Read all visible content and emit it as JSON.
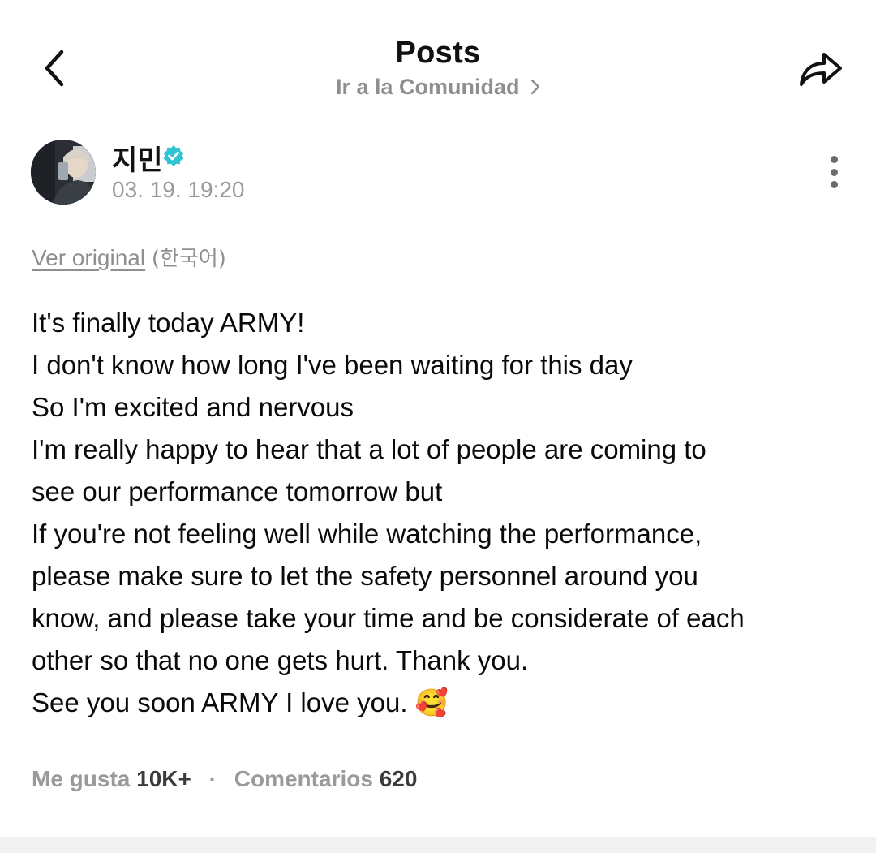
{
  "header": {
    "title": "Posts",
    "community_link": "Ir a la Comunidad",
    "back_icon": "chevron-left-icon",
    "share_icon": "share-arrow-icon"
  },
  "author": {
    "name": "지민",
    "verified": true,
    "verified_color": "#2ec4d6",
    "timestamp": "03. 19. 19:20"
  },
  "translation": {
    "view_original": "Ver original",
    "language": "(한국어)"
  },
  "post": {
    "lines": [
      "It's finally today ARMY!",
      "I don't know how long I've been waiting for this day",
      "So I'm excited and nervous",
      "I'm really happy to hear that a lot of people are coming to",
      "see our performance tomorrow but",
      "If you're not feeling well while watching the performance,",
      "please make sure to let the safety personnel around you",
      "know, and please take your time and be considerate of each",
      "other so that no one gets hurt. Thank you.",
      "See you soon ARMY I love you. 🥰"
    ]
  },
  "stats": {
    "likes_label": "Me gusta",
    "likes_count": "10K+",
    "separator": "·",
    "comments_label": "Comentarios",
    "comments_count": "620"
  }
}
